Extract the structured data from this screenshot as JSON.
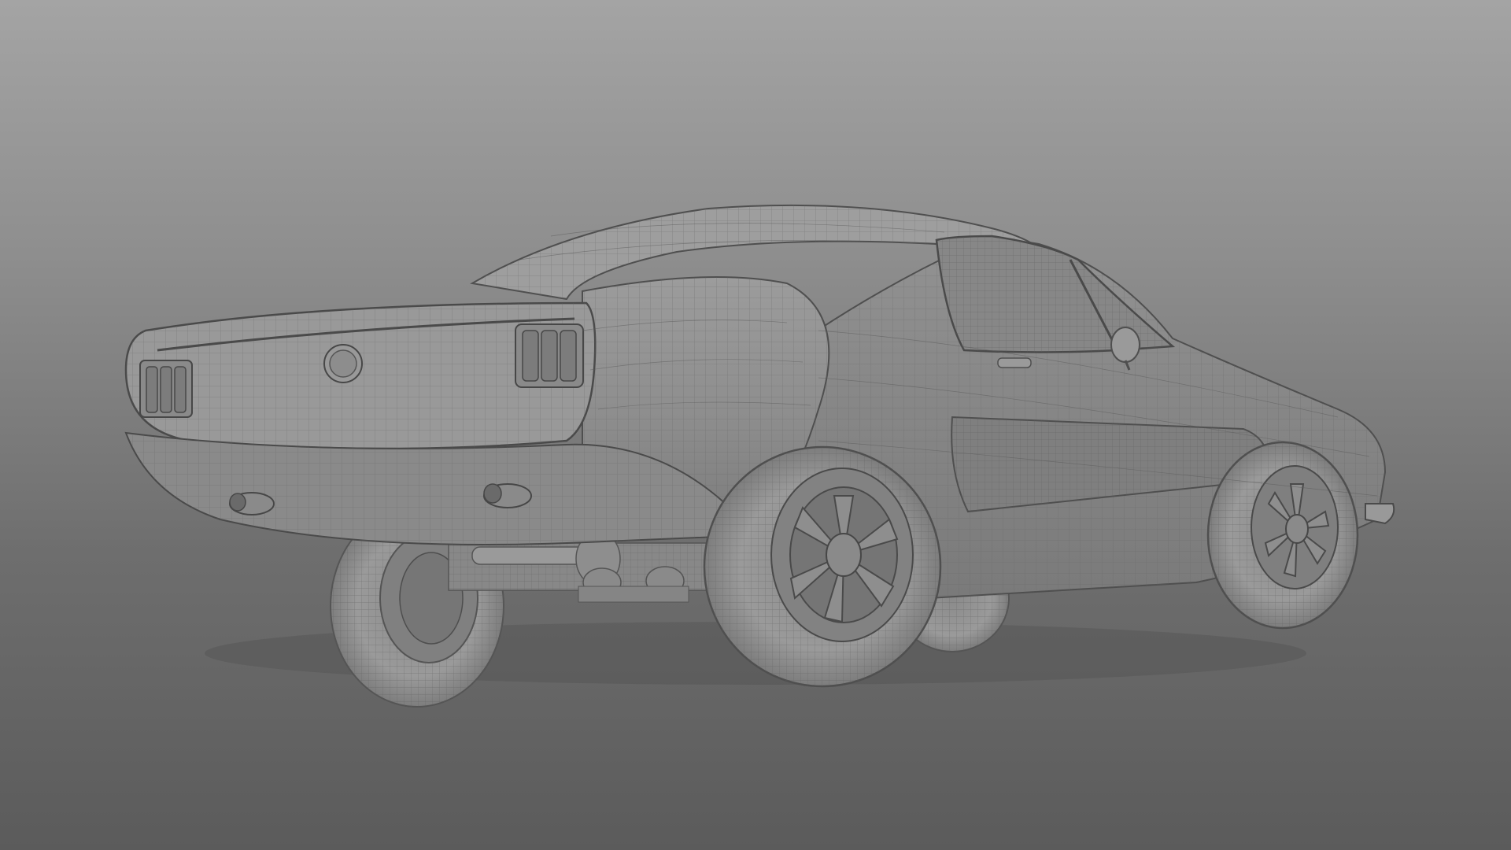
{
  "viewport": {
    "mode": "3d-viewport",
    "shading": "wireframe-on-shaded",
    "background_top": "#a4a4a4",
    "background_bottom": "#5b5b5b",
    "surface_color": "#8f8f8f",
    "wire_color": "#5a5a5a"
  },
  "model": {
    "object": "fastback-coupe",
    "view": "rear-three-quarter-low"
  }
}
